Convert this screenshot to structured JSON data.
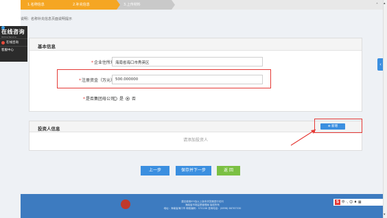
{
  "steps": [
    "1.名称信息",
    "2.补充信息",
    "3.上传材料"
  ],
  "note": "说明：名称补充信息页面说明提示",
  "sidebar": {
    "title": "在线咨询",
    "subtitle": "Online Service",
    "items": [
      "在线咨询",
      "客服中心"
    ]
  },
  "basic_info": {
    "title": "基本信息",
    "fields": [
      {
        "label": "企业住所地:",
        "value": "海南省海口市秀英区",
        "required": true
      },
      {
        "label": "注册资金（万元）:",
        "value": "500.000000",
        "required": true
      },
      {
        "label": "是否集团母公司:",
        "required": true,
        "options": [
          "是",
          "否"
        ],
        "selected": "否"
      }
    ]
  },
  "investor": {
    "title": "投资人信息",
    "add_label": "新增",
    "empty_text": "请添加投资人"
  },
  "buttons": {
    "prev": "上一步",
    "save_next": "保存并下一步",
    "back": "返 回"
  },
  "footer": {
    "line1": "建议使用IE9及以上版本浏览器进行访问",
    "line2": "海南省市场监督管理局 版权所有",
    "line3": "地址：海南省海口市 邮政编码：570206 咨询电话：(0898) 66767530"
  },
  "tray": {
    "s_icon": "S",
    "text": "中 ·, ☺ ♦ ▦"
  },
  "colors": {
    "accent": "#3b8fe0",
    "step_active": "#f5a623",
    "highlight": "#e53935",
    "footer": "#3d7bc0",
    "return": "#7bc043"
  }
}
